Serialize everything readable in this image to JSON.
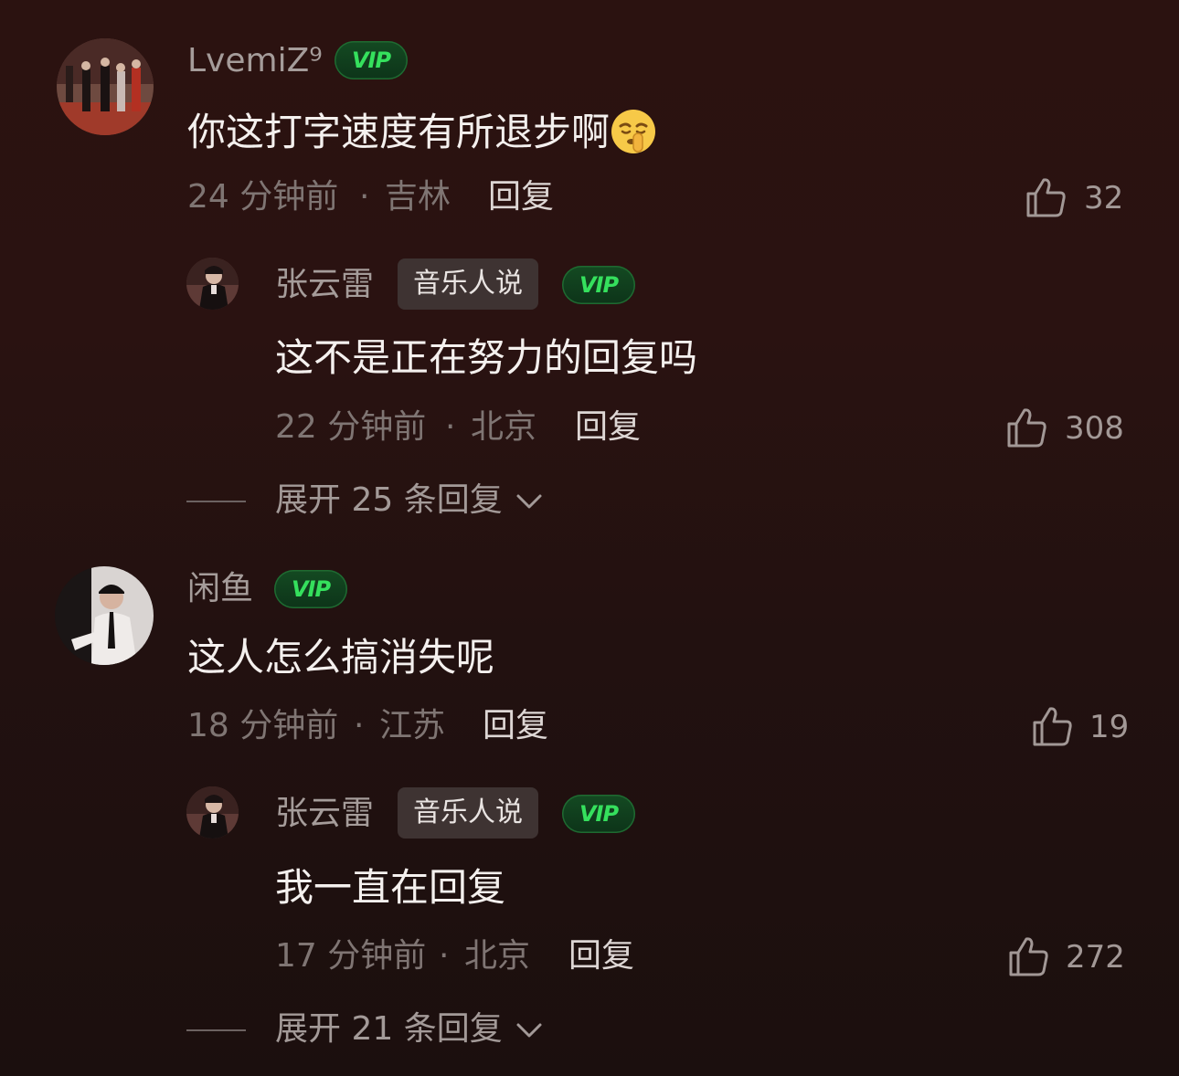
{
  "comments": [
    {
      "username": "LvemiZ⁹",
      "vip_label": "VIP",
      "text": "你这打字速度有所退步啊",
      "emoji": "shushing-face-emoji",
      "time": "24 分钟前",
      "location": "吉林",
      "reply_label": "回复",
      "likes": "32",
      "reply": {
        "username": "张云雷",
        "badge": "音乐人说",
        "vip_label": "VIP",
        "text": "这不是正在努力的回复吗",
        "time": "22 分钟前",
        "location": "北京",
        "reply_label": "回复",
        "likes": "308"
      },
      "expand_label": "展开 25 条回复"
    },
    {
      "username": "闲鱼",
      "vip_label": "VIP",
      "text": "这人怎么搞消失呢",
      "time": "18 分钟前",
      "location": "江苏",
      "reply_label": "回复",
      "likes": "19",
      "reply": {
        "username": "张云雷",
        "badge": "音乐人说",
        "vip_label": "VIP",
        "text": "我一直在回复",
        "time": "17 分钟前",
        "location": "北京",
        "reply_label": "回复",
        "likes": "272"
      },
      "expand_label": "展开 21 条回复"
    }
  ],
  "meta_separator": "·",
  "colors": {
    "background": "#2a1211",
    "vip_green": "#35e05d",
    "meta_gray": "#7f7573"
  }
}
